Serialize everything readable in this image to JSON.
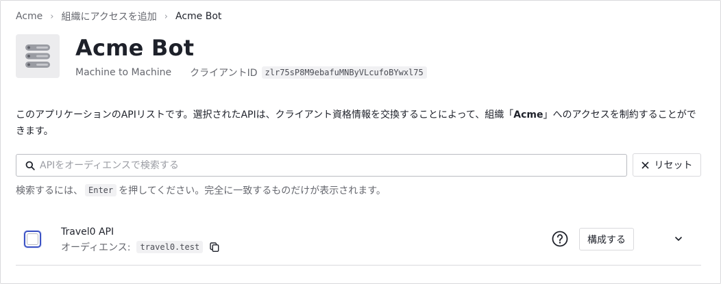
{
  "breadcrumb": {
    "items": [
      "Acme",
      "組織にアクセスを追加",
      "Acme Bot"
    ],
    "separator": "›"
  },
  "app": {
    "icon": "server-icon",
    "name": "Acme Bot",
    "type": "Machine to Machine",
    "client_id_label": "クライアントID",
    "client_id": "zlr75sP8M9ebafuMNByVLcufoBYwxl75"
  },
  "description": {
    "before": "このアプリケーションのAPIリストです。選択されたAPIは、クライアント資格情報を交換することによって、組織「",
    "org": "Acme",
    "after": "」へのアクセスを制約することができます。"
  },
  "search": {
    "placeholder": "APIをオーディエンスで検索する",
    "value": "",
    "icon": "search-icon"
  },
  "reset_button": {
    "label": "リセット",
    "icon": "close-icon"
  },
  "hint": {
    "before": "検索するには、",
    "key": "Enter",
    "after": "を押してください。完全に一致するものだけが表示されます。"
  },
  "apis": [
    {
      "name": "Travel0 API",
      "audience_label": "オーディエンス:",
      "audience": "travel0.test",
      "checked": false,
      "configure_label": "構成する"
    }
  ],
  "colors": {
    "accent": "#3b52c4",
    "text": "#1e212a",
    "muted": "#65676e",
    "border": "#d9d9dc",
    "code_bg": "#f1f1f3"
  }
}
